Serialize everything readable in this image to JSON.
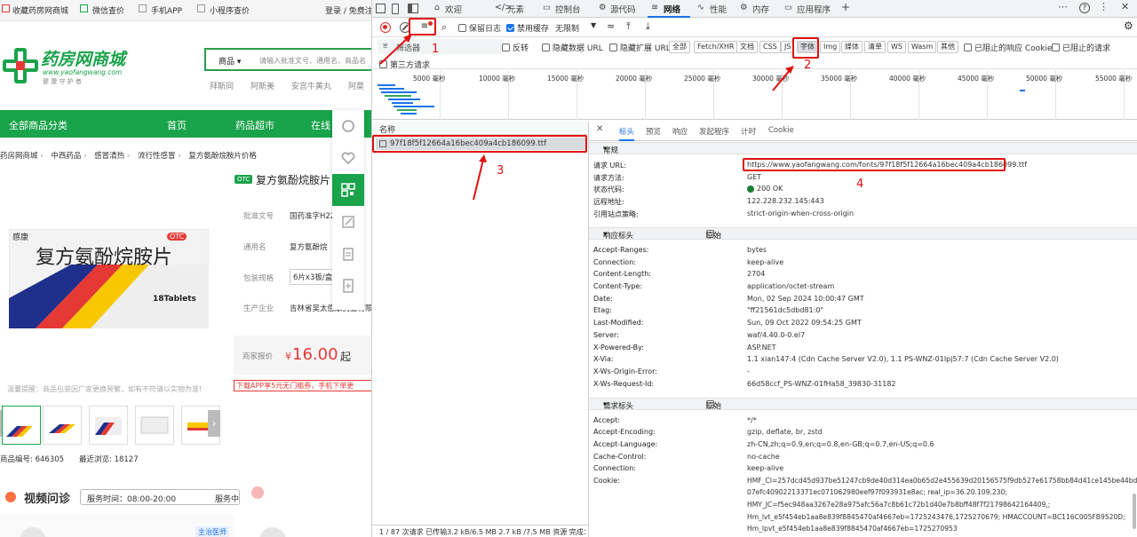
{
  "site": {
    "topbar": {
      "items": [
        "收藏药房网商城",
        "微信查价",
        "手机APP",
        "小程序查价"
      ],
      "login": "登录 / 免费注"
    },
    "logo": {
      "title": "药房网商城",
      "url": "www.yaofangwang.com",
      "slogan": "健 康 守 护 者"
    },
    "search": {
      "category": "商品",
      "placeholder": "请输入批准文号、通用名、商品名"
    },
    "hot_words": [
      "拜斯同",
      "阿斯美",
      "安宫牛黄丸",
      "阿莫"
    ],
    "nav": {
      "category": "全部商品分类",
      "items": [
        "首页",
        "药品超市",
        "在线"
      ]
    },
    "breadcrumb": [
      "药房网商城",
      "中西药品",
      "感冒清热",
      "流行性感冒",
      "复方氨酚烷胺片价格"
    ],
    "product": {
      "otc_badge": "OTC",
      "title": "复方氨酚烷胺片",
      "box_brand": "感康",
      "box_name": "复方氨酚烷胺片",
      "box_otc": "OTC",
      "box_tablets": "18Tablets",
      "fields": [
        {
          "label": "批准文号",
          "value": "国药准字H22"
        },
        {
          "label": "通用名",
          "value": "复方氨酚烷"
        },
        {
          "label": "包装规格",
          "value": "6片x3板/盒"
        },
        {
          "label": "生产企业",
          "value": "吉林省吴太感康药业有限"
        }
      ],
      "price_label": "商家报价",
      "price_symbol": "¥",
      "price": "16.00",
      "price_suffix": "起",
      "promo": "下载APP享5元无门槛券，手机下单更",
      "warning": "温馨提醒：商品包装因厂家更换频繁，如有不符请以实物为准!",
      "code_label": "商品编号:",
      "code": "646305",
      "views_label": "最近浏览:",
      "views": "18127"
    },
    "video": {
      "title": "视频问诊",
      "hours": "服务时间：08:00-20:00",
      "status": "服务中",
      "doctor_badge": "主治医师"
    }
  },
  "devtools": {
    "tabs": [
      "欢迎",
      "元素",
      "控制台",
      "源代码",
      "网络",
      "性能",
      "内存",
      "应用程序"
    ],
    "active_tab": "网络",
    "toolbar": {
      "preserve_log": "保留日志",
      "disable_cache": "禁用缓存",
      "throttle": "无限制"
    },
    "filter": {
      "label": "筛选器",
      "invert": "反转",
      "hide_data_url": "隐藏数据 URL",
      "hide_ext_url": "隐藏扩展 URL",
      "types": [
        "全部",
        "Fetch/XHR",
        "文档",
        "CSS",
        "JS",
        "字体",
        "Img",
        "媒体",
        "清单",
        "WS",
        "Wasm",
        "其他"
      ],
      "selected_type": "字体",
      "blocked_cookies": "已阻止的响应 Cookie",
      "blocked_requests": "已阻止的请求",
      "third_party": "第三方请求"
    },
    "timeline_ticks": [
      "5000 毫秒",
      "10000 毫秒",
      "15000 毫秒",
      "20000 毫秒",
      "25000 毫秒",
      "30000 毫秒",
      "35000 毫秒",
      "40000 毫秒",
      "45000 毫秒",
      "50000 毫秒",
      "55000 毫秒"
    ],
    "requests": {
      "header": "名称",
      "items": [
        "97f18f5f12664a16bec409a4cb186099.ttf"
      ],
      "status_bar": "1 / 87 次请求   已传输3.2 kB/6.5 MB   2.7 kB /7.5 MB 资源   完成："
    },
    "details": {
      "tabs": [
        "标头",
        "预览",
        "响应",
        "发起程序",
        "计时",
        "Cookie"
      ],
      "active_tab": "标头",
      "general_title": "常规",
      "general": [
        {
          "k": "请求 URL:",
          "v": "https://www.yaofangwang.com/fonts/97f18f5f12664a16bec409a4cb186099.ttf"
        },
        {
          "k": "请求方法:",
          "v": "GET"
        },
        {
          "k": "状态代码:",
          "v": "200 OK"
        },
        {
          "k": "远程地址:",
          "v": "122.228.232.145:443"
        },
        {
          "k": "引用站点策略:",
          "v": "strict-origin-when-cross-origin"
        }
      ],
      "response_title": "响应标头",
      "raw_label": "原始",
      "response_headers": [
        {
          "k": "Accept-Ranges:",
          "v": "bytes"
        },
        {
          "k": "Connection:",
          "v": "keep-alive"
        },
        {
          "k": "Content-Length:",
          "v": "2704"
        },
        {
          "k": "Content-Type:",
          "v": "application/octet-stream"
        },
        {
          "k": "Date:",
          "v": "Mon, 02 Sep 2024 10:00:47 GMT"
        },
        {
          "k": "Etag:",
          "v": "\"ff21561dc5dbd81:0\""
        },
        {
          "k": "Last-Modified:",
          "v": "Sun, 09 Oct 2022 09:54:25 GMT"
        },
        {
          "k": "Server:",
          "v": "waf/4.40.0-0.el7"
        },
        {
          "k": "X-Powered-By:",
          "v": "ASP.NET"
        },
        {
          "k": "X-Via:",
          "v": "1.1 xian147:4 (Cdn Cache Server V2.0), 1.1 PS-WNZ-01Ipj57:7 (Cdn Cache Server V2.0)"
        },
        {
          "k": "X-Ws-Origin-Error:",
          "v": "-"
        },
        {
          "k": "X-Ws-Request-Id:",
          "v": "66d58ccf_PS-WNZ-01fHa58_39830-31182"
        }
      ],
      "request_title": "请求标头",
      "request_headers": [
        {
          "k": "Accept:",
          "v": "*/*"
        },
        {
          "k": "Accept-Encoding:",
          "v": "gzip, deflate, br, zstd"
        },
        {
          "k": "Accept-Language:",
          "v": "zh-CN,zh;q=0.9,en;q=0.8,en-GB;q=0.7,en-US;q=0.6"
        },
        {
          "k": "Cache-Control:",
          "v": "no-cache"
        },
        {
          "k": "Connection:",
          "v": "keep-alive"
        },
        {
          "k": "Cookie:",
          "v": "HMF_CI=257dcd45d937be51247cb9de40d314ea0b65d2e455639d20156575f9db527e61758bb84d41ce145be44bdf4d"
        }
      ],
      "cookie_cont": [
        "07efc40902213371ec071062980eef97f093931e8ac; real_ip=36.20.109.230;",
        "HMY_JC=f5ec948aa3267e28a975afc56a7c8b61c72b1d40e7b8bff48f7f21798642164409,;",
        "Hm_lvt_e5f454eb1aa8e839f8845470af4667eb=1725243476,1725270679; HMACCOUNT=BC116C005FB9520D;",
        "Hm_lpvt_e5f454eb1aa8e839f8845470af4667eb=1725270953"
      ]
    }
  },
  "annotations": [
    "1",
    "2",
    "3",
    "4"
  ],
  "colors": {
    "brand_green": "#19a34a",
    "annotation_red": "#e01010",
    "devtools_blue": "#1a73e8"
  }
}
